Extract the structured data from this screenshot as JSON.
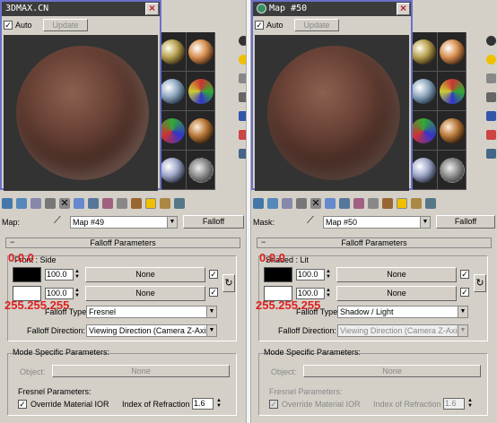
{
  "watermark": "3DMAX.CN",
  "colors": {
    "titlebar": "#3c3c3c",
    "editor_border": "#6a71c9",
    "red_annotation": "#e02020",
    "highlight": "#f0c000"
  },
  "left": {
    "title": "",
    "auto_label": "Auto",
    "update_label": "Update",
    "map_label": "Map:",
    "map_value": "Map #49",
    "falloff_button": "Falloff",
    "rollout_title": "Falloff Parameters",
    "front_side_label": "Front : Side",
    "red_top": "0.0.0",
    "red_bottom": "255.255.255",
    "spinner1": "100.0",
    "spinner2": "100.0",
    "none1": "None",
    "none2": "None",
    "falloff_type_label": "Falloff Type:",
    "falloff_type_value": "Fresnel",
    "falloff_dir_label": "Falloff Direction:",
    "falloff_dir_value": "Viewing Direction (Camera Z-Axis)",
    "mode_label": "Mode Specific Parameters:",
    "object_label": "Object:",
    "object_value": "None",
    "fresnel_label": "Fresnel Parameters:",
    "override_label": "Override Material IOR",
    "ior_label": "Index of Refraction",
    "ior_value": "1.6"
  },
  "right": {
    "title": "Map #50",
    "auto_label": "Auto",
    "update_label": "Update",
    "map_label": "Mask:",
    "map_value": "Map #50",
    "falloff_button": "Falloff",
    "rollout_title": "Falloff Parameters",
    "front_side_label": "Shaded : Lit",
    "red_top": "0.0.0",
    "red_bottom": "255.255.255",
    "spinner1": "100.0",
    "spinner2": "100.0",
    "none1": "None",
    "none2": "None",
    "falloff_type_label": "Falloff Type:",
    "falloff_type_value": "Shadow / Light",
    "falloff_dir_label": "Falloff Direction:",
    "falloff_dir_value": "Viewing Direction (Camera Z-Axis)",
    "mode_label": "Mode Specific Parameters:",
    "object_label": "Object:",
    "object_value": "None",
    "fresnel_label": "Fresnel Parameters:",
    "override_label": "Override Material IOR",
    "ior_label": "Index of Refraction",
    "ior_value": "1.6"
  }
}
